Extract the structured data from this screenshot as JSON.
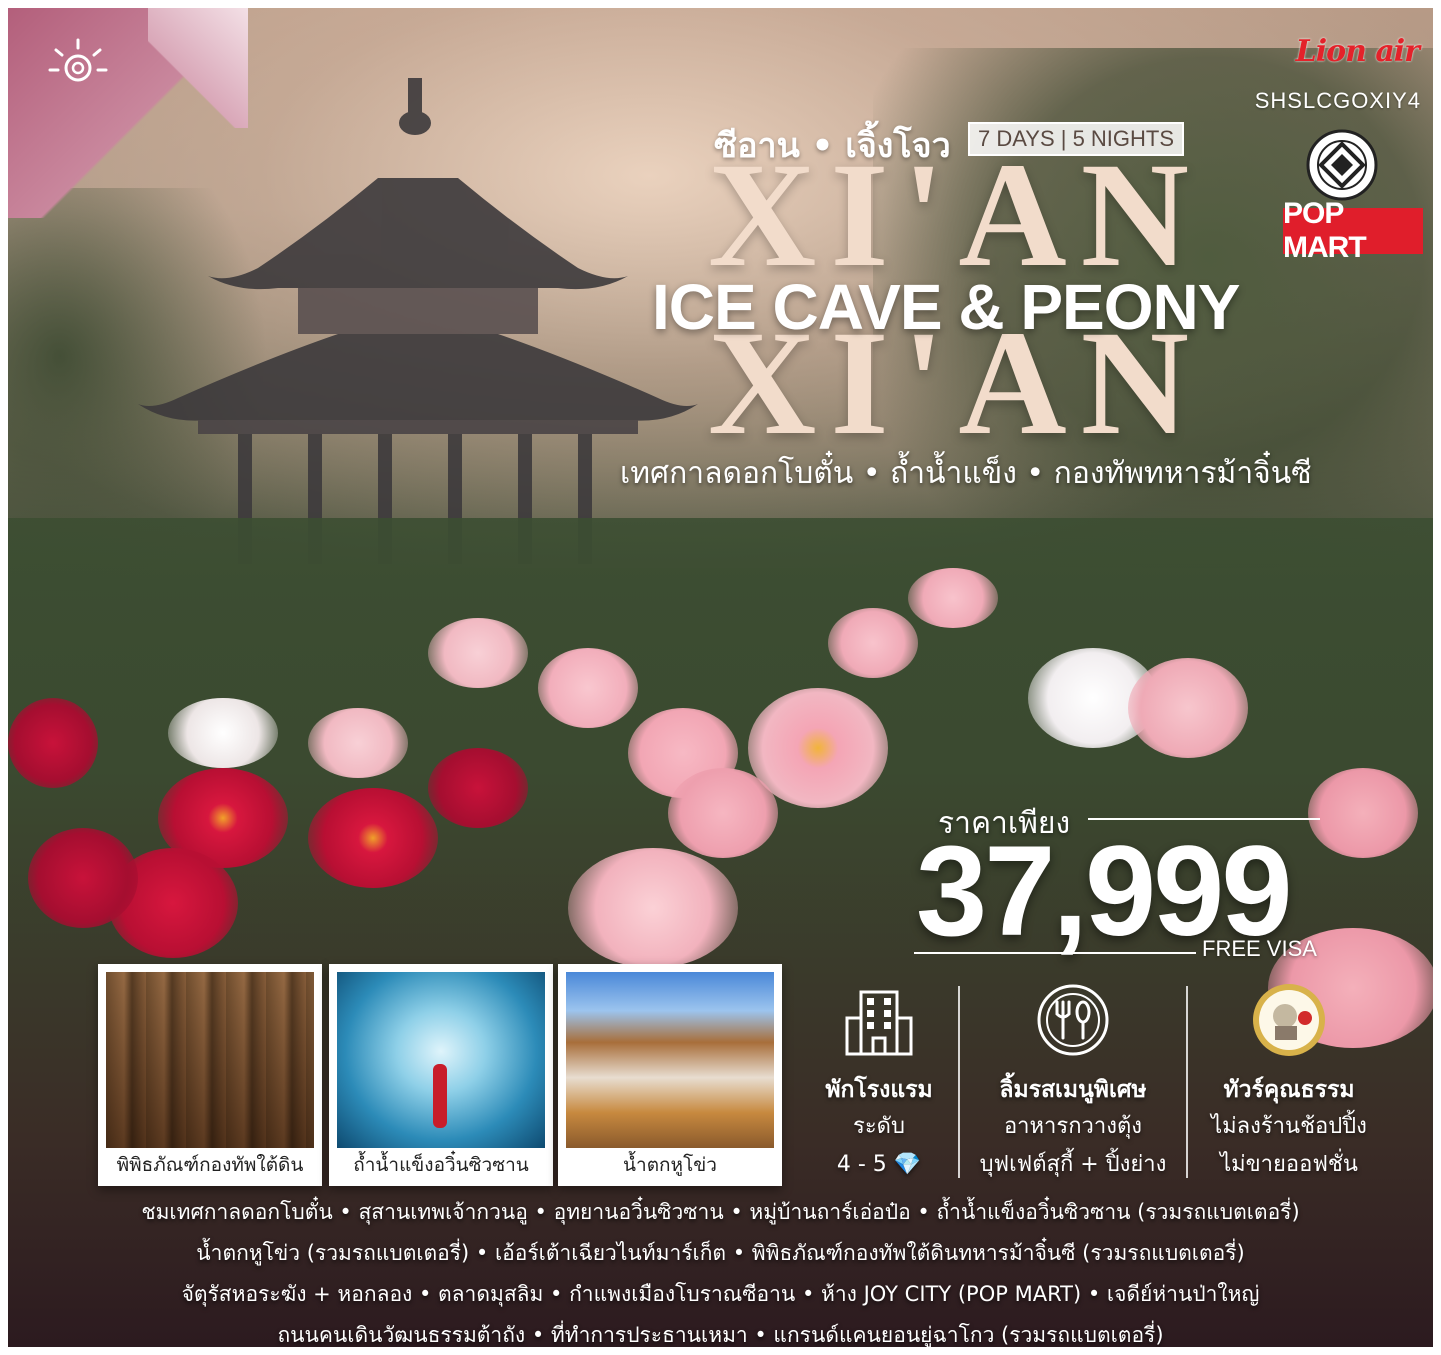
{
  "branding": {
    "airline": "Lion air",
    "tour_code": "SHSLCGOXIY4",
    "popmart": "POP MART"
  },
  "header": {
    "cities_th": "ซีอาน • เจิ้งโจว",
    "duration": "7 DAYS | 5 NIGHTS",
    "big_title_top": "XI'AN",
    "big_title_bottom": "XI'AN",
    "headline": "ICE CAVE & PEONY",
    "subtitle_th": "เทศกาลดอกโบตั๋น • ถ้ำน้ำแข็ง • กองทัพทหารม้าจิ๋นซี"
  },
  "price": {
    "label": "ราคาเพียง",
    "amount": "37,999",
    "note": "FREE VISA"
  },
  "photos": [
    {
      "caption": "พิพิธภัณฑ์กองทัพใต้ดิน"
    },
    {
      "caption": "ถ้ำน้ำแข็งอวิ๋นซิวซาน"
    },
    {
      "caption": "น้ำตกหูโข่ว"
    }
  ],
  "features": [
    {
      "icon": "hotel-icon",
      "title": "พักโรงแรม",
      "line1": "ระดับ",
      "line2": "4 - 5 💎"
    },
    {
      "icon": "dining-icon",
      "title": "ลิ้มรสเมนูพิเศษ",
      "line1": "อาหารกวางตุ้ง",
      "line2": "บุฟเฟต์สุกี้ + ปิ้งย่าง"
    },
    {
      "icon": "ethics-badge-icon",
      "title": "ทัวร์คุณธรรม",
      "line1": "ไม่ลงร้านช้อปปิ้ง",
      "line2": "ไม่ขายออฟชั่น"
    }
  ],
  "itinerary": [
    "ชมเทศกาลดอกโบตั๋น • สุสานเทพเจ้ากวนอู • อุทยานอวิ๋นซิวซาน • หมู่บ้านถาร์เอ่อป๋อ • ถ้ำน้ำแข็งอวิ๋นซิวซาน (รวมรถแบตเตอรี่)",
    "น้ำตกหูโข่ว (รวมรถแบตเตอรี่) • เอ้อร์เต้าเฉียวไนท์มาร์เก็ต • พิพิธภัณฑ์กองทัพใต้ดินทหารม้าจิ๋นซี (รวมรถแบตเตอรี่)",
    "จัตุรัสหอระฆัง + หอกลอง • ตลาดมุสลิม • กำแพงเมืองโบราณซีอาน • ห้าง JOY CITY (POP MART) • เจดีย์ห่านป่าใหญ่",
    "ถนนคนเดินวัฒนธรรมต้าถัง • ที่ทำการประธานเหมา • แกรนด์แคนยอนยู่ฉาโกว (รวมรถแบตเตอรี่)"
  ],
  "colors": {
    "accent_red": "#e01e2b",
    "title_cream": "#f2dccb",
    "fold_pink": "#c9879d"
  }
}
